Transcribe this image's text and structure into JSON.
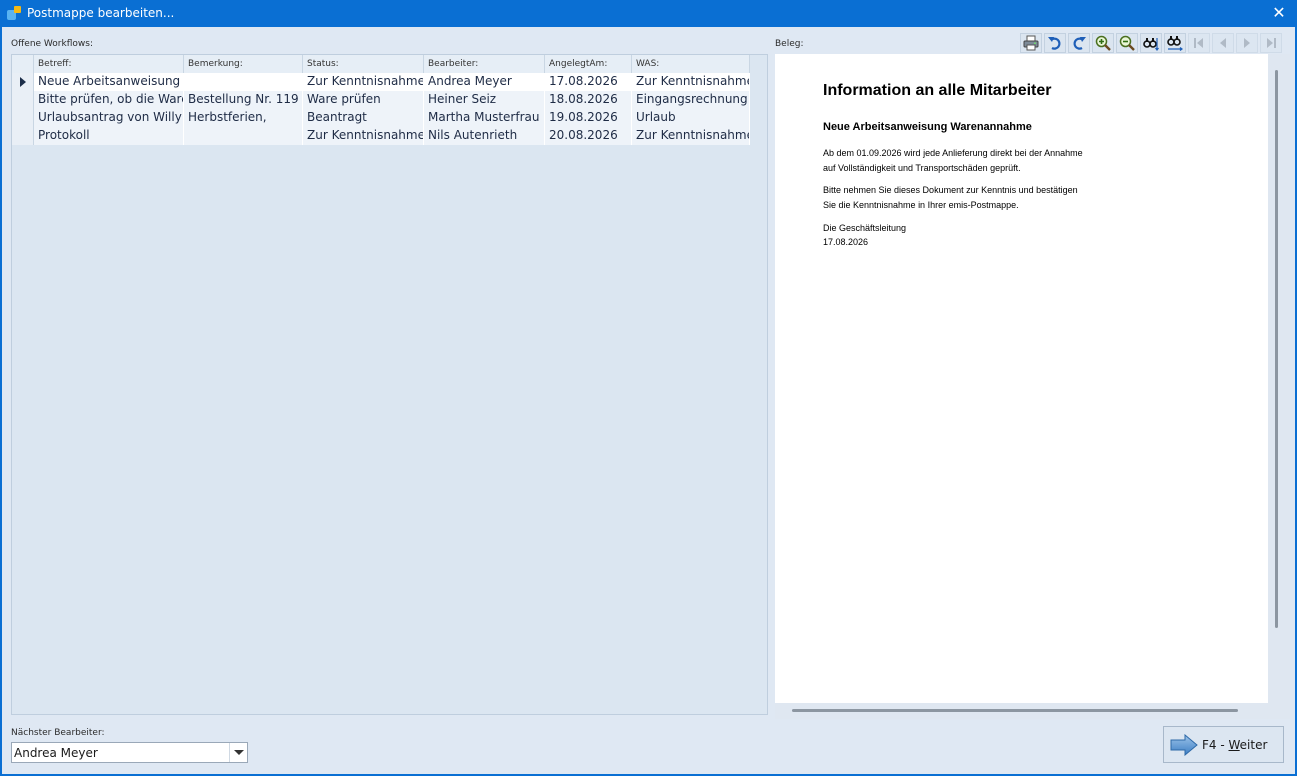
{
  "window": {
    "title": "Postmappe bearbeiten...",
    "close_glyph": "✕"
  },
  "labels": {
    "open_workflows": "Offene Workflows:",
    "beleg": "Beleg:",
    "next_processor": "Nächster Bearbeiter:"
  },
  "grid": {
    "columns": [
      "Betreff:",
      "Bemerkung:",
      "Status:",
      "Bearbeiter:",
      "AngelegtAm:",
      "WAS:"
    ],
    "rows": [
      [
        "Neue Arbeitsanweisung",
        "",
        "Zur Kenntnisnahme",
        "Andrea Meyer",
        "17.08.2026",
        "Zur Kenntnisnahme"
      ],
      [
        "Bitte prüfen, ob die Ware",
        "Bestellung Nr. 119",
        "Ware prüfen",
        "Heiner Seiz",
        "18.08.2026",
        "Eingangsrechnung"
      ],
      [
        "Urlaubsantrag von Willy",
        "Herbstferien,",
        "Beantragt",
        "Martha Musterfrau",
        "19.08.2026",
        "Urlaub"
      ],
      [
        "Protokoll",
        "",
        "Zur Kenntnisnahme",
        "Nils Autenrieth",
        "20.08.2026",
        "Zur Kenntnisnahme"
      ]
    ]
  },
  "toolbar": [
    "print-icon",
    "undo-icon",
    "redo-icon",
    "zoom-in-icon",
    "zoom-out-icon",
    "find-icon",
    "find-next-icon",
    "first-page-icon",
    "previous-page-icon",
    "next-page-icon",
    "last-page-icon"
  ],
  "document": {
    "title": "Information an alle Mitarbeiter",
    "subtitle": "Neue Arbeitsanweisung Warenannahme",
    "lines": [
      "Ab dem 01.09.2026 wird jede Anlieferung direkt bei der Annahme",
      "auf Vollständigkeit und Transportschäden geprüft.",
      "Bitte nehmen Sie dieses Dokument zur Kenntnis und bestätigen",
      "Sie die Kenntnisnahme in Ihrer emis-Postmappe.",
      "Die Geschäftsleitung",
      "17.08.2026"
    ]
  },
  "next_processor": {
    "value": "Andrea Meyer"
  },
  "next_button": {
    "prefix": "F4 - ",
    "underlined": "W",
    "rest": "eiter"
  },
  "colors": {
    "titlebar": "#0a6fd3",
    "background": "#dfe8f3",
    "grid_text": "#1e2b45"
  }
}
